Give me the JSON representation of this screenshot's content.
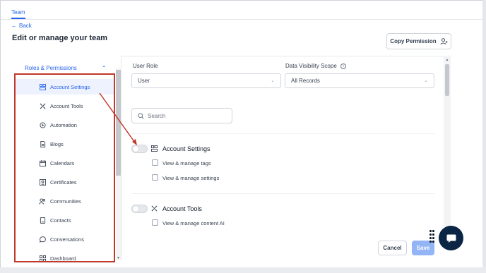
{
  "tabs": {
    "team": "Team"
  },
  "nav": {
    "back": "Back"
  },
  "header": {
    "title": "Edit or manage your team",
    "copy_permission": "Copy Permission"
  },
  "sidebar": {
    "heading": "Roles & Permissions",
    "items": [
      {
        "label": "Account Settings",
        "icon": "settings-grid-icon",
        "active": true
      },
      {
        "label": "Account Tools",
        "icon": "tools-icon"
      },
      {
        "label": "Automation",
        "icon": "automation-icon"
      },
      {
        "label": "Blogs",
        "icon": "document-icon"
      },
      {
        "label": "Calendars",
        "icon": "calendar-icon"
      },
      {
        "label": "Certificates",
        "icon": "certificate-icon"
      },
      {
        "label": "Communities",
        "icon": "users-icon"
      },
      {
        "label": "Contacts",
        "icon": "contact-book-icon"
      },
      {
        "label": "Conversations",
        "icon": "chat-icon"
      },
      {
        "label": "Dashboard",
        "icon": "dashboard-grid-icon"
      }
    ]
  },
  "form": {
    "user_role": {
      "label": "User Role",
      "value": "User"
    },
    "data_visibility": {
      "label": "Data Visibility Scope",
      "value": "All Records"
    },
    "search": {
      "placeholder": "Search"
    }
  },
  "sections": [
    {
      "title": "Account Settings",
      "enabled": false,
      "permissions": [
        "View & manage tags",
        "View & manage settings"
      ]
    },
    {
      "title": "Account Tools",
      "enabled": false,
      "permissions": [
        "View & manage content AI"
      ]
    }
  ],
  "footer": {
    "cancel": "Cancel",
    "save": "Save"
  },
  "colors": {
    "accent": "#2563eb",
    "highlight": "#c0392b",
    "save_disabled": "#93b4f5",
    "chat_bubble": "#0b2545"
  }
}
